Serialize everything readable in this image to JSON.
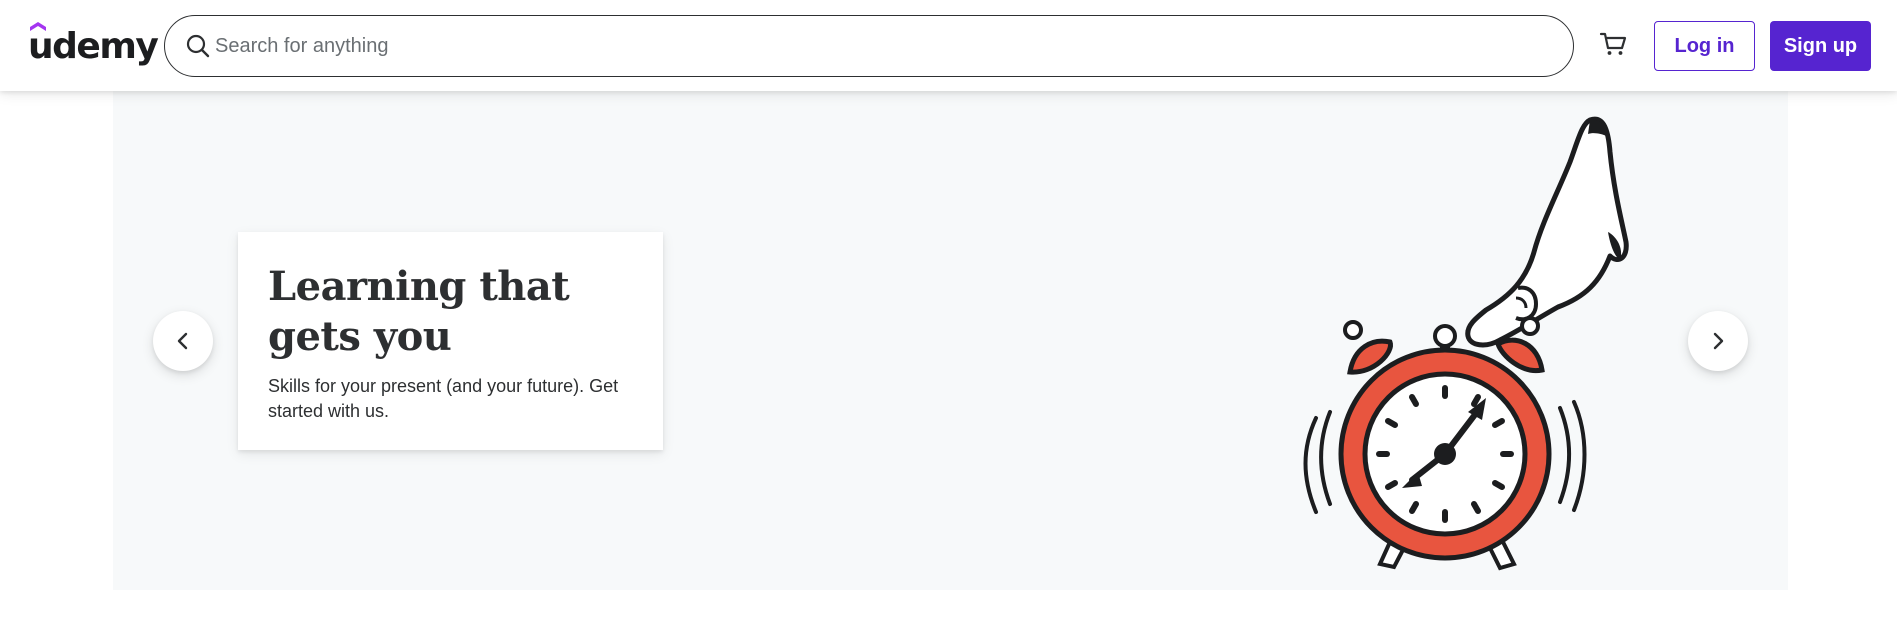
{
  "header": {
    "logo_text": "udemy",
    "search": {
      "placeholder": "Search for anything",
      "value": ""
    },
    "cart_icon": "cart-icon",
    "login_label": "Log in",
    "signup_label": "Sign up"
  },
  "hero": {
    "title": "Learning that gets you",
    "subtitle": "Skills for your present (and your future). Get started with us.",
    "prev_icon": "chevron-left-icon",
    "next_icon": "chevron-right-icon",
    "illustration": "alarm-clock-with-hand"
  },
  "colors": {
    "brand_purple": "#5624d0",
    "text_dark": "#2d2f31",
    "hero_bg": "#f7f9fa",
    "clock_red": "#e8553f"
  }
}
